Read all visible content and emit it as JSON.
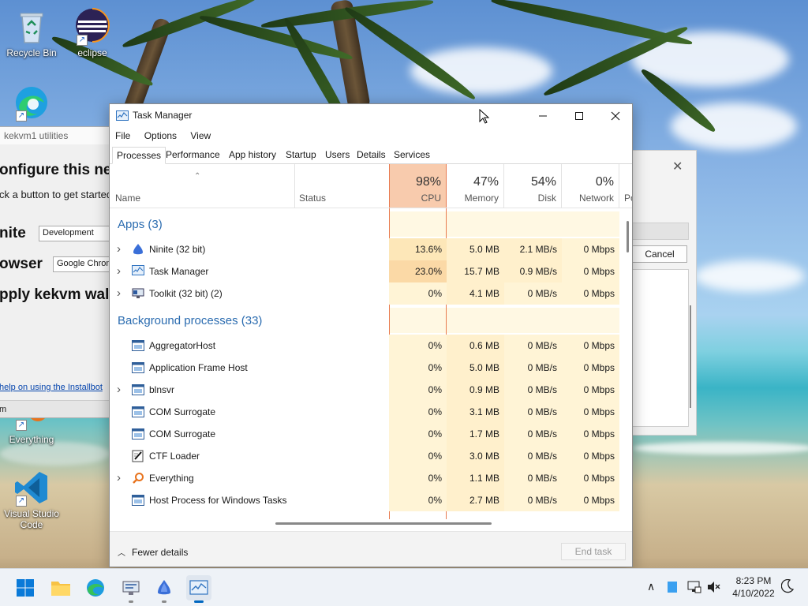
{
  "desktop": {
    "icons": [
      {
        "label": "Recycle Bin",
        "icon": "recycle-bin-icon"
      },
      {
        "label": "eclipse",
        "icon": "eclipse-icon"
      },
      {
        "label": "Everything",
        "icon": "everything-icon"
      },
      {
        "label": "Visual Studio Code",
        "icon": "vscode-icon"
      }
    ]
  },
  "installbot": {
    "title": "kekvm1 utilities",
    "heading": "onfigure this ne",
    "subtext": "ck a button to get started",
    "ninite_label": "nite",
    "ninite_value": "Development",
    "browser_label": "owser",
    "browser_value": "Google Chrom",
    "apply_label": "pply kekvm wal",
    "help_link": "help on using the Installbot",
    "footer_text": "m"
  },
  "dialog_back": {
    "cancel_label": "Cancel"
  },
  "taskmanager": {
    "title": "Task Manager",
    "menu": [
      "File",
      "Options",
      "View"
    ],
    "tabs": [
      "Processes",
      "Performance",
      "App history",
      "Startup",
      "Users",
      "Details",
      "Services"
    ],
    "active_tab": "Processes",
    "columns": {
      "name": "Name",
      "status": "Status",
      "cpu": {
        "pct": "98%",
        "label": "CPU"
      },
      "memory": {
        "pct": "47%",
        "label": "Memory"
      },
      "disk": {
        "pct": "54%",
        "label": "Disk"
      },
      "network": {
        "pct": "0%",
        "label": "Network"
      },
      "power": "Po"
    },
    "groups": {
      "apps": "Apps (3)",
      "background": "Background processes (33)"
    },
    "apps": [
      {
        "name": "Ninite (32 bit)",
        "cpu": "13.6%",
        "memory": "5.0 MB",
        "disk": "2.1 MB/s",
        "network": "0 Mbps",
        "icon": "ninite-icon",
        "expandable": true
      },
      {
        "name": "Task Manager",
        "cpu": "23.0%",
        "memory": "15.7 MB",
        "disk": "0.9 MB/s",
        "network": "0 Mbps",
        "icon": "task-manager-icon",
        "expandable": true
      },
      {
        "name": "Toolkit (32 bit) (2)",
        "cpu": "0%",
        "memory": "4.1 MB",
        "disk": "0 MB/s",
        "network": "0 Mbps",
        "icon": "toolkit-icon",
        "expandable": true
      }
    ],
    "background": [
      {
        "name": "AggregatorHost",
        "cpu": "0%",
        "memory": "0.6 MB",
        "disk": "0 MB/s",
        "network": "0 Mbps",
        "icon": "service-icon",
        "expandable": false
      },
      {
        "name": "Application Frame Host",
        "cpu": "0%",
        "memory": "5.0 MB",
        "disk": "0 MB/s",
        "network": "0 Mbps",
        "icon": "service-icon",
        "expandable": false
      },
      {
        "name": "blnsvr",
        "cpu": "0%",
        "memory": "0.9 MB",
        "disk": "0 MB/s",
        "network": "0 Mbps",
        "icon": "service-icon",
        "expandable": true
      },
      {
        "name": "COM Surrogate",
        "cpu": "0%",
        "memory": "3.1 MB",
        "disk": "0 MB/s",
        "network": "0 Mbps",
        "icon": "service-icon",
        "expandable": false
      },
      {
        "name": "COM Surrogate",
        "cpu": "0%",
        "memory": "1.7 MB",
        "disk": "0 MB/s",
        "network": "0 Mbps",
        "icon": "service-icon",
        "expandable": false
      },
      {
        "name": "CTF Loader",
        "cpu": "0%",
        "memory": "3.0 MB",
        "disk": "0 MB/s",
        "network": "0 Mbps",
        "icon": "ctf-loader-icon",
        "expandable": false
      },
      {
        "name": "Everything",
        "cpu": "0%",
        "memory": "1.1 MB",
        "disk": "0 MB/s",
        "network": "0 Mbps",
        "icon": "everything-icon",
        "expandable": true
      },
      {
        "name": "Host Process for Windows Tasks",
        "cpu": "0%",
        "memory": "2.7 MB",
        "disk": "0 MB/s",
        "network": "0 Mbps",
        "icon": "service-icon",
        "expandable": false
      }
    ],
    "footer": {
      "fewer_details": "Fewer details",
      "end_task": "End task"
    },
    "colors": {
      "cpu_header": "#f8cbad",
      "cpu_high": "#fbd9a6",
      "cpu_mid": "#fde7b8",
      "cell_low": "#fff4d6",
      "accent_border": "#e87a4f",
      "group_blue": "#2b6cb0"
    }
  },
  "taskbar": {
    "items": [
      "start-icon",
      "file-explorer-icon",
      "edge-icon",
      "toolkit-icon",
      "ninite-icon",
      "task-manager-icon"
    ],
    "time": "8:23 PM",
    "date": "4/10/2022"
  }
}
